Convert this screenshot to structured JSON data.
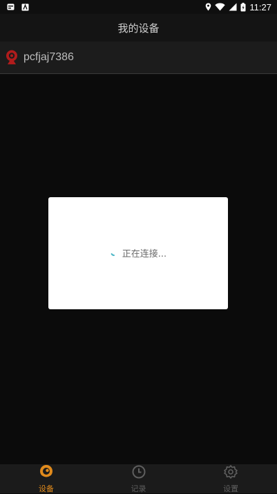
{
  "status_bar": {
    "time": "11:27",
    "left_icons": [
      "notification-image-icon",
      "notification-app-icon"
    ],
    "right_icons": [
      "location-icon",
      "wifi-icon",
      "cellular-icon",
      "battery-icon"
    ]
  },
  "header": {
    "title": "我的设备"
  },
  "device": {
    "name": "pcfjaj7386",
    "icon": "camera-device-icon",
    "icon_color": "#b01c1c"
  },
  "dialog": {
    "message": "正在连接..."
  },
  "tabs": [
    {
      "label": "设备",
      "icon": "device-eye-icon",
      "active": true
    },
    {
      "label": "记录",
      "icon": "clock-icon",
      "active": false
    },
    {
      "label": "设置",
      "icon": "gear-icon",
      "active": false
    }
  ],
  "colors": {
    "accent": "#e08a1c",
    "spinner": "#4bb6c6",
    "inactive": "#5f5f5f"
  }
}
